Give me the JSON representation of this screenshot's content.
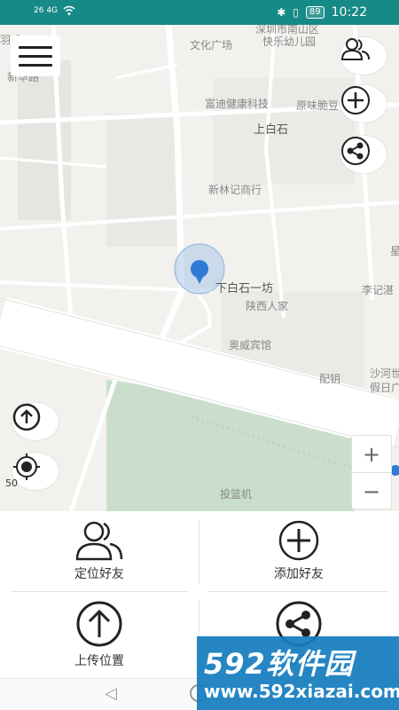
{
  "status_bar": {
    "signal_left": "26 4G",
    "battery": "89",
    "time": "10:22"
  },
  "map": {
    "labels": [
      {
        "text": "深圳市南山区"
      },
      {
        "text": "快乐幼儿园"
      },
      {
        "text": "文化广场"
      },
      {
        "text": "富迪健康科技"
      },
      {
        "text": "原味脆豆"
      },
      {
        "text": "上白石"
      },
      {
        "text": "新林记商行"
      },
      {
        "text": "下白石一坊"
      },
      {
        "text": "陕西人家"
      },
      {
        "text": "奥威宾馆"
      },
      {
        "text": "李记湛"
      },
      {
        "text": "配钥"
      },
      {
        "text": "沙河世"
      },
      {
        "text": "假日广"
      },
      {
        "text": "投篮机"
      },
      {
        "text": "新华路"
      },
      {
        "text": "羽毛"
      },
      {
        "text": "星"
      }
    ],
    "scale_text": "50",
    "zoom_in": "+",
    "zoom_out": "−"
  },
  "panel": {
    "locate_friend": "定位好友",
    "add_friend": "添加好友",
    "upload_location": "上传位置",
    "share": "分享"
  },
  "watermark": {
    "big": "592软件园",
    "small": "www.592xiazai.com"
  },
  "colors": {
    "status_bar": "#168a86",
    "location_marker": "#2e7bd6",
    "watermark": "#147dbe"
  }
}
